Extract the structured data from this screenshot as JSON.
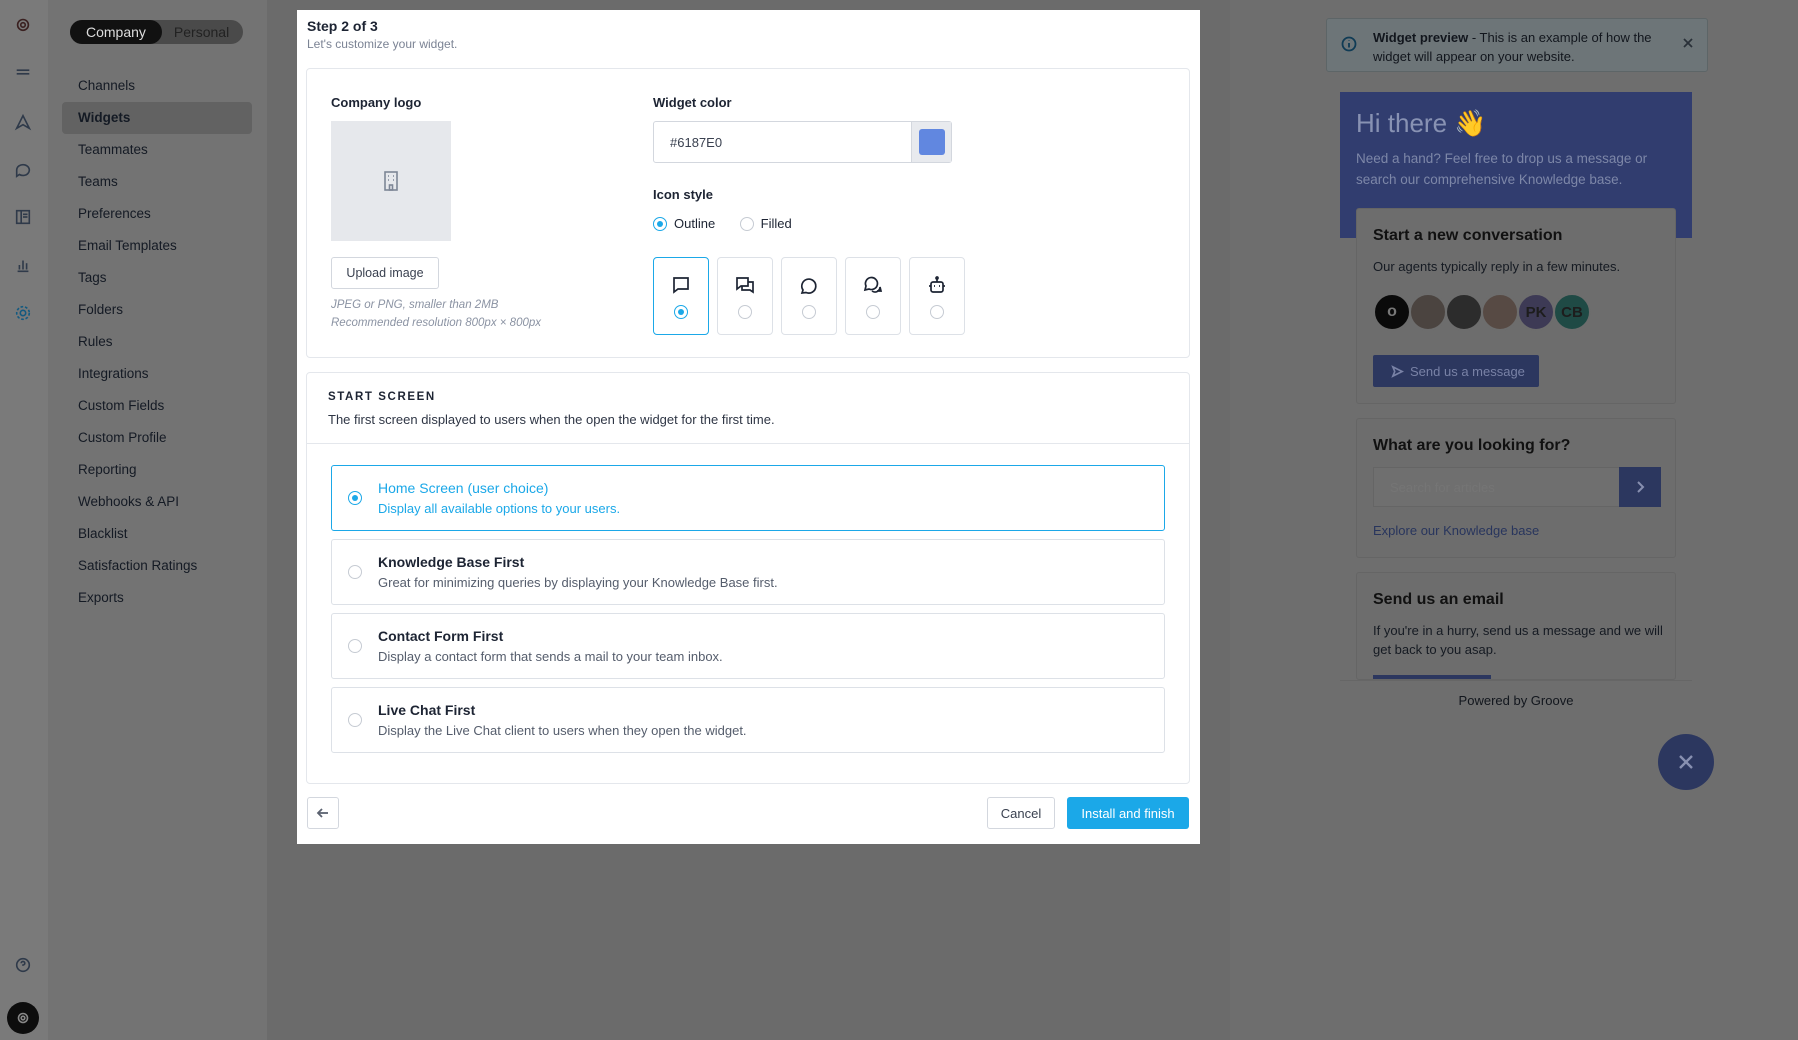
{
  "sidebar": {
    "toggle": {
      "company": "Company",
      "personal": "Personal"
    },
    "items": [
      {
        "label": "Channels"
      },
      {
        "label": "Widgets"
      },
      {
        "label": "Teammates"
      },
      {
        "label": "Teams"
      },
      {
        "label": "Preferences"
      },
      {
        "label": "Email Templates"
      },
      {
        "label": "Tags"
      },
      {
        "label": "Folders"
      },
      {
        "label": "Rules"
      },
      {
        "label": "Integrations"
      },
      {
        "label": "Custom Fields"
      },
      {
        "label": "Custom Profile"
      },
      {
        "label": "Reporting"
      },
      {
        "label": "Webhooks & API"
      },
      {
        "label": "Blacklist"
      },
      {
        "label": "Satisfaction Ratings"
      },
      {
        "label": "Exports"
      }
    ],
    "active": "Widgets"
  },
  "modal": {
    "step_title": "Step 2 of 3",
    "step_subtitle": "Let's customize your widget.",
    "company_logo_label": "Company logo",
    "upload_label": "Upload image",
    "hint_line1": "JPEG or PNG, smaller than 2MB",
    "hint_line2": "Recommended resolution 800px × 800px",
    "widget_color_label": "Widget color",
    "widget_color_value": "#6187E0",
    "icon_style_label": "Icon style",
    "icon_style_options": {
      "outline": "Outline",
      "filled": "Filled"
    },
    "icon_style_selected": "Outline",
    "icon_tiles": [
      "chat-square-icon",
      "chat-double-icon",
      "chat-round-icon",
      "chat-round-double-icon",
      "robot-icon"
    ],
    "start_screen": {
      "heading": "START SCREEN",
      "description": "The first screen displayed to users when the open the widget for the first time.",
      "options": [
        {
          "title": "Home Screen (user choice)",
          "desc": "Display all available options to your users."
        },
        {
          "title": "Knowledge Base First",
          "desc": "Great for minimizing queries by displaying your Knowledge Base first."
        },
        {
          "title": "Contact Form First",
          "desc": "Display a contact form that sends a mail to your team inbox."
        },
        {
          "title": "Live Chat First",
          "desc": "Display the Live Chat client to users when they open the widget."
        }
      ]
    },
    "cancel_label": "Cancel",
    "install_label": "Install and finish"
  },
  "preview": {
    "notice_bold": "Widget preview",
    "notice_text": " - This is an example of how the widget will appear on your website.",
    "greeting": "Hi there 👋",
    "greeting_sub": "Need a hand? Feel free to drop us a message or search our comprehensive Knowledge base.",
    "conversation_title": "Start a new conversation",
    "conversation_sub": "Our agents typically reply in a few minutes.",
    "avatars": [
      "",
      "",
      "",
      "",
      "PK",
      "CB"
    ],
    "send_message_label": "Send us a message",
    "looking_title": "What are you looking for?",
    "search_placeholder": "Search for articles",
    "explore_label": "Explore our Knowledge base",
    "email_title": "Send us an email",
    "email_sub": "If you're in a hurry, send us a message and we will get back to you asap.",
    "powered_by": "Powered by Groove"
  },
  "colors": {
    "accent": "#1BA8E8",
    "widget": "#6187E0",
    "widget_dimmed": "#313D6F"
  }
}
